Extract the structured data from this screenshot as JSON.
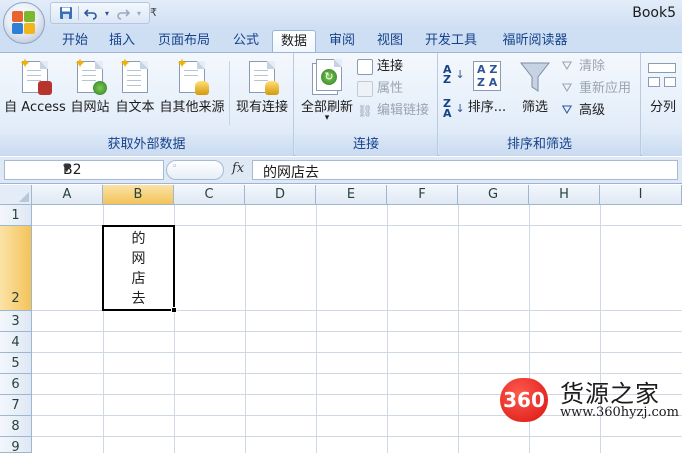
{
  "window": {
    "title": "Book5"
  },
  "quick_access": {
    "save_icon": "save-icon",
    "undo_icon": "undo-icon",
    "redo_icon": "redo-icon",
    "more_icon": "customize-qat-icon"
  },
  "tabs": [
    {
      "label": "开始",
      "active": false
    },
    {
      "label": "插入",
      "active": false
    },
    {
      "label": "页面布局",
      "active": false
    },
    {
      "label": "公式",
      "active": false
    },
    {
      "label": "数据",
      "active": true
    },
    {
      "label": "审阅",
      "active": false
    },
    {
      "label": "视图",
      "active": false
    },
    {
      "label": "开发工具",
      "active": false
    },
    {
      "label": "福昕阅读器",
      "active": false
    }
  ],
  "ribbon": {
    "external_data": {
      "label": "获取外部数据",
      "buttons": [
        {
          "label": "自 Access"
        },
        {
          "label": "自网站"
        },
        {
          "label": "自文本"
        },
        {
          "label": "自其他来源"
        },
        {
          "label": "现有连接"
        }
      ]
    },
    "connections": {
      "label": "连接",
      "refresh_all": "全部刷新",
      "connections": "连接",
      "properties": "属性",
      "edit_links": "编辑链接"
    },
    "sort_filter": {
      "label": "排序和筛选",
      "sort": "排序...",
      "filter": "筛选",
      "clear": "清除",
      "reapply": "重新应用",
      "advanced": "高级"
    },
    "data_tools": {
      "split": "分列"
    }
  },
  "formula_bar": {
    "name_box": "B2",
    "fx_label": "fx",
    "content": "的网店去"
  },
  "sheet": {
    "columns": [
      "A",
      "B",
      "C",
      "D",
      "E",
      "F",
      "G",
      "H",
      "I"
    ],
    "rows": [
      "1",
      "2",
      "3",
      "4",
      "5",
      "6",
      "7",
      "8",
      "9"
    ],
    "selected_cell": "B2",
    "cell_b2_chars": [
      "的",
      "网",
      "店",
      "去"
    ]
  },
  "watermark": {
    "badge": "360",
    "name": "货源之家",
    "url": "www.360hyzj.com"
  },
  "colors": {
    "ribbon_bg": "#e3edf9",
    "tab_text": "#15428b",
    "selection_header": "#f3c35a",
    "watermark_red": "#d8140f"
  }
}
